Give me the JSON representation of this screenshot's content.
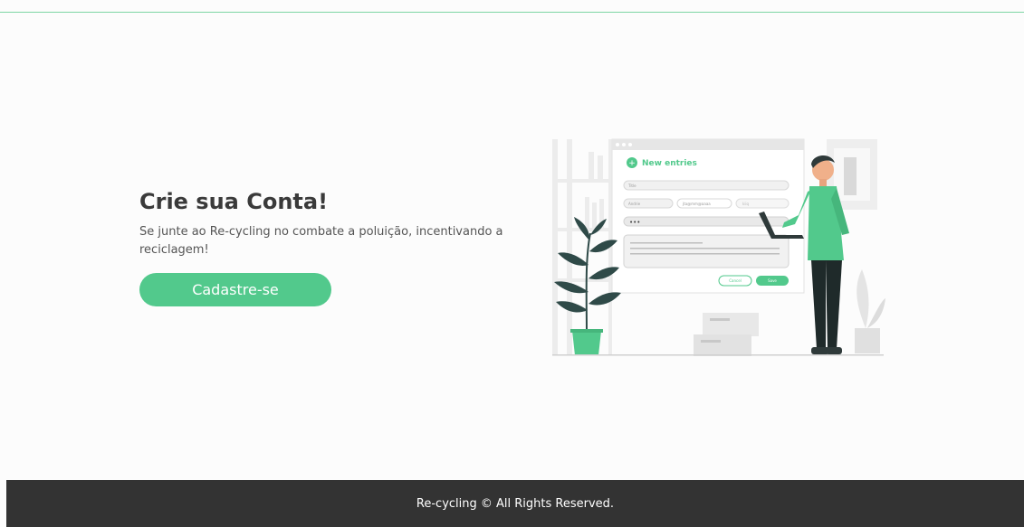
{
  "hero": {
    "title": "Crie sua Conta!",
    "subtitle": "Se junte ao Re-cycling no combate a poluição, incentivando a reciclagem!",
    "button_label": "Cadastre-se"
  },
  "illustration": {
    "form_title": "New entries",
    "title_field": "Title",
    "field_one": "Andrie",
    "field_two": "jta@mm@aaaa",
    "field_three": "kiiq",
    "password_dots": "•••",
    "cancel_label": "Cancel",
    "save_label": "Save"
  },
  "footer": {
    "text": "Re-cycling © All Rights Reserved."
  },
  "colors": {
    "accent": "#52c98c",
    "footer_bg": "#333333",
    "heading": "#3a3a3a"
  }
}
